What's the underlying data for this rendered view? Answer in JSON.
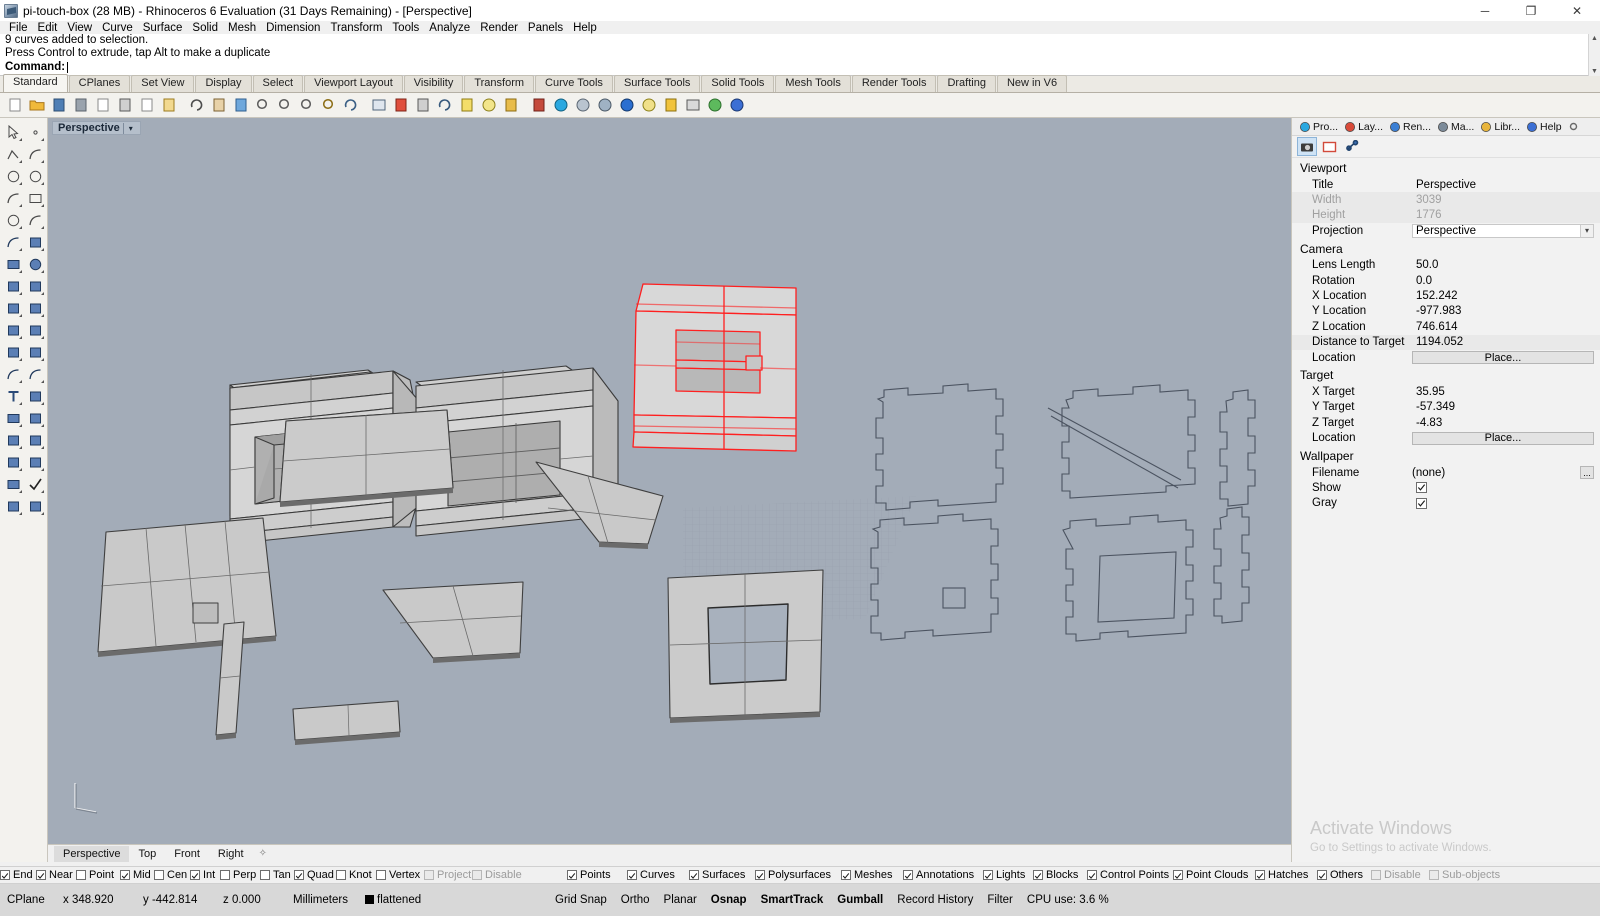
{
  "window": {
    "title": "pi-touch-box (28 MB) - Rhinoceros 6 Evaluation (31 Days Remaining) - [Perspective]",
    "minimize": "─",
    "maximize": "❐",
    "close": "✕"
  },
  "menu": [
    "File",
    "Edit",
    "View",
    "Curve",
    "Surface",
    "Solid",
    "Mesh",
    "Dimension",
    "Transform",
    "Tools",
    "Analyze",
    "Render",
    "Panels",
    "Help"
  ],
  "command": {
    "history_line1": "9 curves added to selection.",
    "history_line2": "Press Control to extrude, tap Alt to make a duplicate",
    "prompt_label": "Command:",
    "prompt_value": ""
  },
  "toolbar_tabs": [
    {
      "label": "Standard",
      "active": true
    },
    {
      "label": "CPlanes",
      "active": false
    },
    {
      "label": "Set View",
      "active": false
    },
    {
      "label": "Display",
      "active": false
    },
    {
      "label": "Select",
      "active": false
    },
    {
      "label": "Viewport Layout",
      "active": false
    },
    {
      "label": "Visibility",
      "active": false
    },
    {
      "label": "Transform",
      "active": false
    },
    {
      "label": "Curve Tools",
      "active": false
    },
    {
      "label": "Surface Tools",
      "active": false
    },
    {
      "label": "Solid Tools",
      "active": false
    },
    {
      "label": "Mesh Tools",
      "active": false
    },
    {
      "label": "Render Tools",
      "active": false
    },
    {
      "label": "Drafting",
      "active": false
    },
    {
      "label": "New in V6",
      "active": false
    }
  ],
  "standard_toolbar_icons": [
    "new-file-icon",
    "open-folder-icon",
    "save-icon",
    "print-icon",
    "copy-page-icon",
    "cut-scissors-icon",
    "copy-icon",
    "paste-clipboard-icon",
    "undo-icon",
    "pan-hand-icon",
    "move-icon",
    "zoom-window-icon",
    "zoom-extents-icon",
    "zoom-selected-icon",
    "zoom-dynamic-icon",
    "rotate-view-icon",
    "grid-icon",
    "layer-red-icon",
    "layer-edit-icon",
    "rotate-arc-icon",
    "properties-icon",
    "point-light-icon",
    "lock-icon",
    "render-mesh-icon",
    "color-wheel-icon",
    "shade-icon",
    "render-preview-icon",
    "render-blue-icon",
    "spotlight-icon",
    "options-gear-icon",
    "boundingbox-icon",
    "globe-icon",
    "help-icon"
  ],
  "left_toolbar_icons": [
    "select-arrow-icon",
    "point-icon",
    "polyline-icon",
    "curve-icon",
    "circle-icon",
    "ellipse-icon",
    "control-point-curve-icon",
    "rectangle-icon",
    "circle-center-icon",
    "arc-icon",
    "surface-from-curves-icon",
    "surface-patch-icon",
    "box-icon",
    "sphere-boolean-icon",
    "cylinder-icon",
    "extrude-icon",
    "explode-icon",
    "trim-icon",
    "split-icon",
    "offset-surface-icon",
    "boolean-union-icon",
    "boolean-difference-icon",
    "fillet-icon",
    "chamfer-icon",
    "text-icon",
    "dimension-icon",
    "block-icon",
    "array-icon",
    "solid-tools-icon",
    "mesh-tools-icon",
    "grid-array-icon",
    "analyze-icon",
    "layout-icon",
    "check-icon",
    "render-icon",
    "light-icon"
  ],
  "viewport": {
    "label": "Perspective",
    "dropdown_glyph": "▾",
    "background_color": "#a3acb8",
    "selected_object_color": "#ff0000",
    "tabs": [
      {
        "label": "Perspective",
        "active": true
      },
      {
        "label": "Top",
        "active": false
      },
      {
        "label": "Front",
        "active": false
      },
      {
        "label": "Right",
        "active": false
      }
    ],
    "tabs_add_glyph": "✧"
  },
  "right_panel": {
    "tabs": [
      {
        "label": "Pro...",
        "icon": "properties-color-wheel-icon",
        "active": true
      },
      {
        "label": "Lay...",
        "icon": "layers-icon",
        "active": false
      },
      {
        "label": "Ren...",
        "icon": "render-sphere-icon",
        "active": false
      },
      {
        "label": "Ma...",
        "icon": "materials-brush-icon",
        "active": false
      },
      {
        "label": "Libr...",
        "icon": "libraries-folder-icon",
        "active": false
      },
      {
        "label": "Help",
        "icon": "help-panel-icon",
        "active": false
      }
    ],
    "settings_icon": "gear-icon",
    "tool_buttons": [
      {
        "name": "camera-icon",
        "selected": true
      },
      {
        "name": "viewport-frame-icon",
        "selected": false
      },
      {
        "name": "link-chain-icon",
        "selected": false
      }
    ],
    "sections": [
      {
        "title": "Viewport",
        "rows": [
          {
            "key": "Title",
            "value": "Perspective",
            "type": "text",
            "dim": false,
            "shade": false
          },
          {
            "key": "Width",
            "value": "3039",
            "type": "text",
            "dim": true,
            "shade": true
          },
          {
            "key": "Height",
            "value": "1776",
            "type": "text",
            "dim": true,
            "shade": true
          },
          {
            "key": "Projection",
            "value": "Perspective",
            "type": "select",
            "dim": false,
            "shade": false
          }
        ]
      },
      {
        "title": "Camera",
        "rows": [
          {
            "key": "Lens Length",
            "value": "50.0",
            "type": "text",
            "dim": false,
            "shade": false
          },
          {
            "key": "Rotation",
            "value": "0.0",
            "type": "text",
            "dim": false,
            "shade": false
          },
          {
            "key": "X Location",
            "value": "152.242",
            "type": "text",
            "dim": false,
            "shade": false
          },
          {
            "key": "Y Location",
            "value": "-977.983",
            "type": "text",
            "dim": false,
            "shade": false
          },
          {
            "key": "Z Location",
            "value": "746.614",
            "type": "text",
            "dim": false,
            "shade": false
          },
          {
            "key": "Distance to Target",
            "value": "1194.052",
            "type": "text",
            "dim": false,
            "shade": true
          },
          {
            "key": "Location",
            "value": "Place...",
            "type": "button",
            "dim": false,
            "shade": false
          }
        ]
      },
      {
        "title": "Target",
        "rows": [
          {
            "key": "X Target",
            "value": "35.95",
            "type": "text",
            "dim": false,
            "shade": false
          },
          {
            "key": "Y Target",
            "value": "-57.349",
            "type": "text",
            "dim": false,
            "shade": false
          },
          {
            "key": "Z Target",
            "value": "-4.83",
            "type": "text",
            "dim": false,
            "shade": false
          },
          {
            "key": "Location",
            "value": "Place...",
            "type": "button",
            "dim": false,
            "shade": false
          }
        ]
      },
      {
        "title": "Wallpaper",
        "rows": [
          {
            "key": "Filename",
            "value": "(none)",
            "type": "file",
            "dim": false,
            "shade": false
          },
          {
            "key": "Show",
            "value": "",
            "type": "checkbox",
            "checked": true,
            "dim": false,
            "shade": false
          },
          {
            "key": "Gray",
            "value": "",
            "type": "checkbox",
            "checked": true,
            "dim": false,
            "shade": false
          }
        ]
      }
    ]
  },
  "watermark": {
    "line1": "Activate Windows",
    "line2": "Go to Settings to activate Windows."
  },
  "osnap": [
    {
      "label": "End",
      "checked": true,
      "disabled": false
    },
    {
      "label": "Near",
      "checked": true,
      "disabled": false
    },
    {
      "label": "Point",
      "checked": false,
      "disabled": false
    },
    {
      "label": "Mid",
      "checked": true,
      "disabled": false
    },
    {
      "label": "Cen",
      "checked": false,
      "disabled": false
    },
    {
      "label": "Int",
      "checked": true,
      "disabled": false
    },
    {
      "label": "Perp",
      "checked": false,
      "disabled": false
    },
    {
      "label": "Tan",
      "checked": false,
      "disabled": false
    },
    {
      "label": "Quad",
      "checked": true,
      "disabled": false
    },
    {
      "label": "Knot",
      "checked": false,
      "disabled": false
    },
    {
      "label": "Vertex",
      "checked": false,
      "disabled": false
    },
    {
      "label": "Project",
      "checked": false,
      "disabled": true
    },
    {
      "label": "Disable",
      "checked": false,
      "disabled": true
    }
  ],
  "selection_filter": [
    {
      "label": "Points",
      "checked": true,
      "disabled": false
    },
    {
      "label": "Curves",
      "checked": true,
      "disabled": false
    },
    {
      "label": "Surfaces",
      "checked": true,
      "disabled": false
    },
    {
      "label": "Polysurfaces",
      "checked": true,
      "disabled": false
    },
    {
      "label": "Meshes",
      "checked": true,
      "disabled": false
    },
    {
      "label": "Annotations",
      "checked": true,
      "disabled": false
    },
    {
      "label": "Lights",
      "checked": true,
      "disabled": false
    },
    {
      "label": "Blocks",
      "checked": true,
      "disabled": false
    },
    {
      "label": "Control Points",
      "checked": true,
      "disabled": false
    },
    {
      "label": "Point Clouds",
      "checked": true,
      "disabled": false
    },
    {
      "label": "Hatches",
      "checked": true,
      "disabled": false
    },
    {
      "label": "Others",
      "checked": true,
      "disabled": false
    },
    {
      "label": "Disable",
      "checked": false,
      "disabled": true
    },
    {
      "label": "Sub-objects",
      "checked": false,
      "disabled": true
    }
  ],
  "statusbar": {
    "cplane": "CPlane",
    "x": "x 348.920",
    "y": "y -442.814",
    "z": "z 0.000",
    "units": "Millimeters",
    "layer": "flattened",
    "layer_color": "#000000",
    "toggles": [
      {
        "label": "Grid Snap",
        "bold": false
      },
      {
        "label": "Ortho",
        "bold": false
      },
      {
        "label": "Planar",
        "bold": false
      },
      {
        "label": "Osnap",
        "bold": true
      },
      {
        "label": "SmartTrack",
        "bold": true
      },
      {
        "label": "Gumball",
        "bold": true
      },
      {
        "label": "Record History",
        "bold": false
      },
      {
        "label": "Filter",
        "bold": false
      }
    ],
    "cpu": "CPU use: 3.6 %"
  }
}
